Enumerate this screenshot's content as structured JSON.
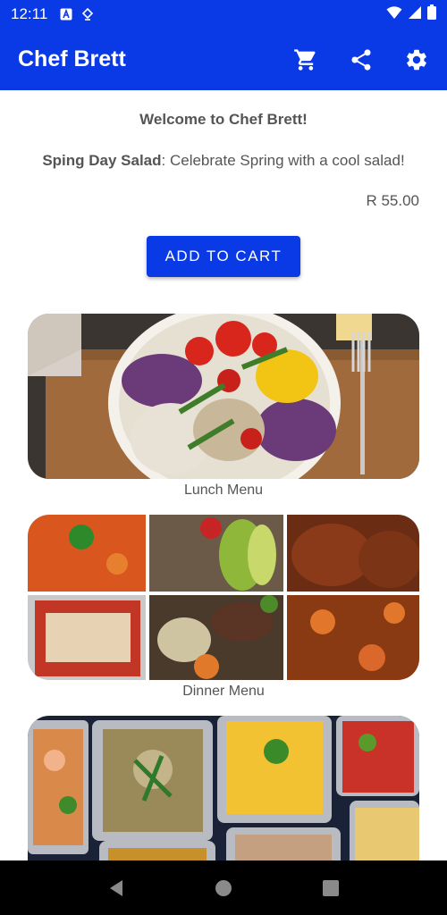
{
  "status_bar": {
    "time": "12:11"
  },
  "app_bar": {
    "title": "Chef Brett"
  },
  "content": {
    "welcome": "Welcome to Chef Brett!",
    "special_name": "Sping Day Salad",
    "special_desc": ": Celebrate Spring with a cool salad!",
    "price": "R 55.00",
    "add_to_cart_label": "ADD TO CART"
  },
  "menus": [
    {
      "label": "Lunch Menu"
    },
    {
      "label": "Dinner Menu"
    }
  ],
  "colors": {
    "primary": "#0a3ae6",
    "text": "#555555"
  },
  "icons": [
    "cart-icon",
    "share-icon",
    "settings-icon",
    "back-icon",
    "home-icon",
    "recents-icon"
  ]
}
